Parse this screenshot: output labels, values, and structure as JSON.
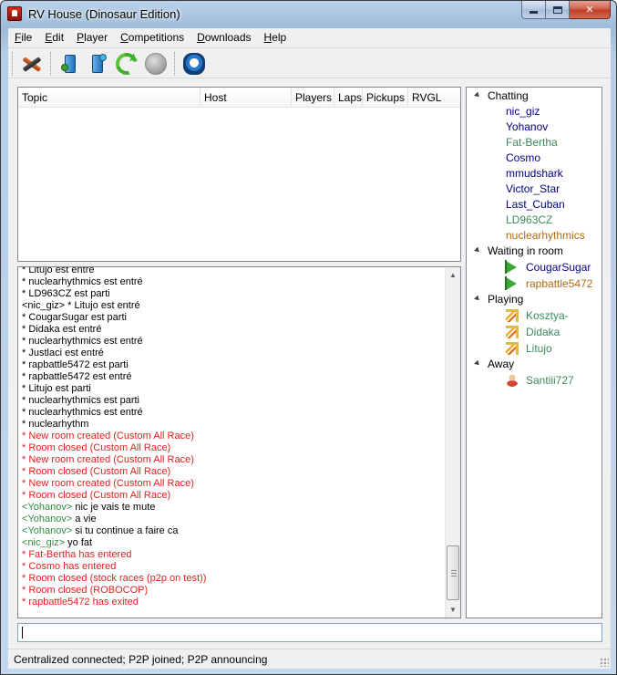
{
  "window": {
    "title": "RV House (Dinosaur Edition)",
    "caption_buttons": [
      "minimize",
      "maximize",
      "close"
    ]
  },
  "menu": [
    {
      "label": "File",
      "accel": "F",
      "rest": "ile"
    },
    {
      "label": "Edit",
      "accel": "E",
      "rest": "dit"
    },
    {
      "label": "Player",
      "accel": "P",
      "rest": "layer"
    },
    {
      "label": "Competitions",
      "accel": "C",
      "rest": "ompetitions"
    },
    {
      "label": "Downloads",
      "accel": "D",
      "rest": "ownloads"
    },
    {
      "label": "Help",
      "accel": "H",
      "rest": "elp"
    }
  ],
  "toolbar": {
    "icons": [
      "disconnect-icon",
      "host-room-icon",
      "join-room-icon",
      "refresh-icon",
      "disabled-icon",
      "network-icon"
    ]
  },
  "rooms": {
    "columns": [
      "Topic",
      "Host",
      "Players",
      "Laps",
      "Pickups",
      "RVGL"
    ],
    "rows": []
  },
  "chat": {
    "lines": [
      {
        "kind": "sys",
        "text": "* Litujo est entré"
      },
      {
        "kind": "sys",
        "text": "* nuclearhythmics est entré"
      },
      {
        "kind": "sys",
        "text": "* LD963CZ est parti"
      },
      {
        "kind": "sys",
        "text": "<nic_giz> * Litujo est entré"
      },
      {
        "kind": "sys",
        "text": "* CougarSugar est parti"
      },
      {
        "kind": "sys",
        "text": "* Didaka est entré"
      },
      {
        "kind": "sys",
        "text": "* nuclearhythmics est entré"
      },
      {
        "kind": "sys",
        "text": "* Justlaci est entré"
      },
      {
        "kind": "sys",
        "text": "* rapbattle5472 est parti"
      },
      {
        "kind": "sys",
        "text": "* rapbattle5472 est entré"
      },
      {
        "kind": "sys",
        "text": "* Litujo est parti"
      },
      {
        "kind": "sys",
        "text": "* nuclearhythmics est parti"
      },
      {
        "kind": "sys",
        "text": "* nuclearhythmics est entré"
      },
      {
        "kind": "sys",
        "text": "* nuclearhythm"
      },
      {
        "kind": "evt",
        "text": "* New room created (Custom All Race)"
      },
      {
        "kind": "evt",
        "text": "* Room closed (Custom All Race)"
      },
      {
        "kind": "evt",
        "text": "* New room created (Custom All Race)"
      },
      {
        "kind": "evt",
        "text": "* Room closed (Custom All Race)"
      },
      {
        "kind": "evt",
        "text": "* New room created (Custom All Race)"
      },
      {
        "kind": "evt",
        "text": "* Room closed (Custom All Race)"
      },
      {
        "kind": "msg",
        "nick": "Yohanov",
        "text": "nic je vais te mute"
      },
      {
        "kind": "msg",
        "nick": "Yohanov",
        "text": "a vie"
      },
      {
        "kind": "msg",
        "nick": "Yohanov",
        "text": "si tu continue a faire ca"
      },
      {
        "kind": "msg",
        "nick": "nic_giz",
        "text": "yo fat"
      },
      {
        "kind": "evt",
        "text": "* Fat-Bertha has entered"
      },
      {
        "kind": "evt",
        "text": "* Cosmo has entered"
      },
      {
        "kind": "evt",
        "text": "* Room closed (stock races (p2p on test))"
      },
      {
        "kind": "evt",
        "text": "* Room closed (ROBOCOP)"
      },
      {
        "kind": "evt",
        "text": "* rapbattle5472 has exited"
      }
    ]
  },
  "users": {
    "groups": [
      {
        "label": "Chatting",
        "members": [
          {
            "name": "nic_giz",
            "color": "#000080",
            "icon": ""
          },
          {
            "name": "Yohanov",
            "color": "#000080",
            "icon": ""
          },
          {
            "name": "Fat-Bertha",
            "color": "#3c8a5a",
            "icon": ""
          },
          {
            "name": "Cosmo",
            "color": "#000080",
            "icon": ""
          },
          {
            "name": "mmudshark",
            "color": "#000080",
            "icon": ""
          },
          {
            "name": "Victor_Star",
            "color": "#000080",
            "icon": ""
          },
          {
            "name": "Last_Cuban",
            "color": "#000080",
            "icon": ""
          },
          {
            "name": "LD963CZ",
            "color": "#3c8a5a",
            "icon": ""
          },
          {
            "name": "nuclearhythmics",
            "color": "#b06a10",
            "icon": ""
          }
        ]
      },
      {
        "label": "Waiting in room",
        "members": [
          {
            "name": "CougarSugar",
            "color": "#000080",
            "icon": "flag-icon"
          },
          {
            "name": "rapbattle5472",
            "color": "#b06a10",
            "icon": "flag-icon"
          }
        ]
      },
      {
        "label": "Playing",
        "members": [
          {
            "name": "Kosztya-",
            "color": "#3c8a5a",
            "icon": "playing-icon"
          },
          {
            "name": "Didaka",
            "color": "#3c8a5a",
            "icon": "playing-icon"
          },
          {
            "name": "Litujo",
            "color": "#3c8a5a",
            "icon": "playing-icon"
          }
        ]
      },
      {
        "label": "Away",
        "members": [
          {
            "name": "Santiii727",
            "color": "#3c8a5a",
            "icon": "away-icon"
          }
        ]
      }
    ]
  },
  "input": {
    "value": ""
  },
  "status": {
    "text": "Centralized connected; P2P joined; P2P announcing"
  }
}
